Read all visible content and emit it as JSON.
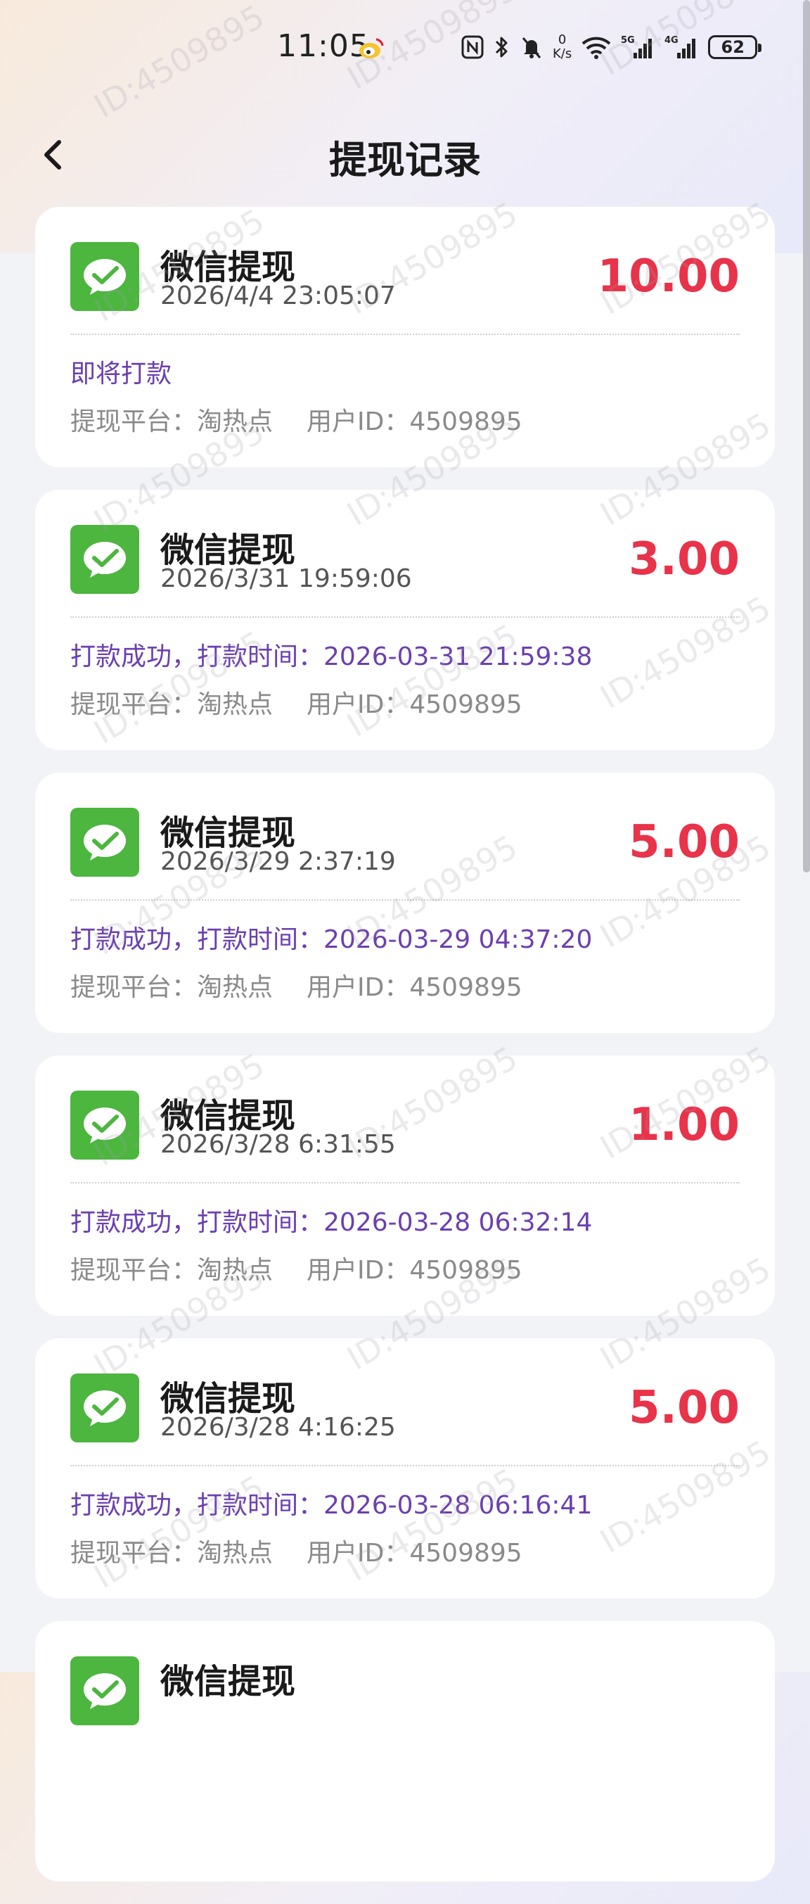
{
  "status_bar": {
    "time": "11:05",
    "net_speed_value": "0",
    "net_speed_unit": "K/s",
    "signal_1_label": "5G",
    "signal_2_label": "4G",
    "battery": "62"
  },
  "header": {
    "title": "提现记录"
  },
  "records": [
    {
      "title": "微信提现",
      "time": "2026/4/4 23:05:07",
      "amount": "10.00",
      "status": "即将打款",
      "platform": "提现平台：淘热点",
      "user": "用户ID：4509895"
    },
    {
      "title": "微信提现",
      "time": "2026/3/31 19:59:06",
      "amount": "3.00",
      "status": "打款成功，打款时间：2026-03-31 21:59:38",
      "platform": "提现平台：淘热点",
      "user": "用户ID：4509895"
    },
    {
      "title": "微信提现",
      "time": "2026/3/29 2:37:19",
      "amount": "5.00",
      "status": "打款成功，打款时间：2026-03-29 04:37:20",
      "platform": "提现平台：淘热点",
      "user": "用户ID：4509895"
    },
    {
      "title": "微信提现",
      "time": "2026/3/28 6:31:55",
      "amount": "1.00",
      "status": "打款成功，打款时间：2026-03-28 06:32:14",
      "platform": "提现平台：淘热点",
      "user": "用户ID：4509895"
    },
    {
      "title": "微信提现",
      "time": "2026/3/28 4:16:25",
      "amount": "5.00",
      "status": "打款成功，打款时间：2026-03-28 06:16:41",
      "platform": "提现平台：淘热点",
      "user": "用户ID：4509895"
    },
    {
      "title": "微信提现"
    }
  ],
  "watermark_text": "ID:4509895",
  "colors": {
    "amount": "#e8334a",
    "status": "#6b3fb0",
    "wechat_green": "#4cb63f"
  },
  "icons": {
    "back": "chevron-left-icon",
    "wechat": "wechat-icon"
  }
}
